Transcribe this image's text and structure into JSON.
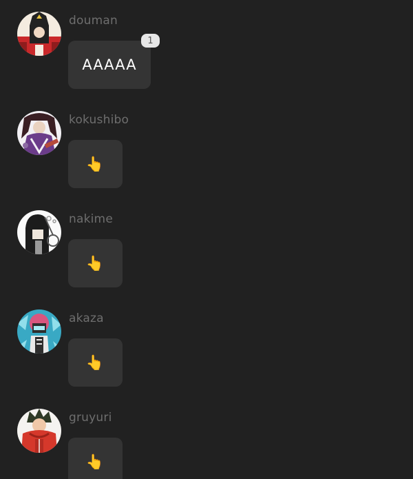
{
  "messages": [
    {
      "username": "douman",
      "avatar": "douman-avatar",
      "content_type": "text",
      "text": "AAAAA",
      "reply_count": "1",
      "colors": {
        "bg": "#f4ece0",
        "primary": "#c9282a",
        "secondary": "#222222",
        "accent": "#e8c441"
      }
    },
    {
      "username": "kokushibo",
      "avatar": "kokushibo-avatar",
      "content_type": "emoji",
      "emoji": "👆",
      "colors": {
        "bg": "#f2f0f4",
        "primary": "#6b3c8a",
        "secondary": "#3a1f24",
        "accent": "#b64a3a"
      }
    },
    {
      "username": "nakime",
      "avatar": "nakime-avatar",
      "content_type": "emoji",
      "emoji": "👆",
      "colors": {
        "bg": "#fafafa",
        "primary": "#1c1c1c",
        "secondary": "#9a9a9a",
        "accent": "#555555"
      }
    },
    {
      "username": "akaza",
      "avatar": "akaza-avatar",
      "content_type": "emoji",
      "emoji": "👆",
      "colors": {
        "bg": "#39a9c4",
        "primary": "#d9567f",
        "secondary": "#2e2e2e",
        "accent": "#a7ecf5"
      }
    },
    {
      "username": "gruyuri",
      "avatar": "gruyuri-avatar",
      "content_type": "emoji",
      "emoji": "👆",
      "colors": {
        "bg": "#f5f3f0",
        "primary": "#d5382b",
        "secondary": "#2f3a26",
        "accent": "#f0c8a8"
      }
    }
  ]
}
